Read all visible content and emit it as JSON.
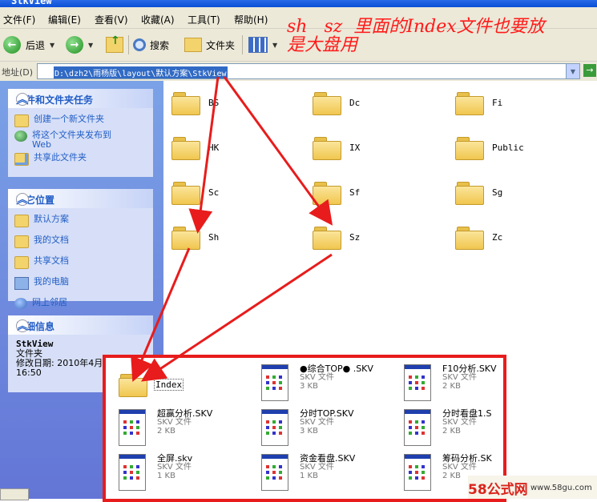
{
  "window": {
    "title": "StkView"
  },
  "menu": [
    "文件(F)",
    "编辑(E)",
    "查看(V)",
    "收藏(A)",
    "工具(T)",
    "帮助(H)"
  ],
  "toolbar": {
    "back": "后退",
    "search": "搜索",
    "folders": "文件夹"
  },
  "annotation": "sh   sz  里面的Index文件也要放\n是大盘用",
  "address": {
    "label": "地址(D)",
    "path": "D:\\dzh2\\雨杨版\\layout\\默认方案\\StkView"
  },
  "tasks_panel": {
    "title": "文件和文件夹任务",
    "items": [
      "创建一个新文件夹",
      "将这个文件夹发布到\nWeb",
      "共享此文件夹"
    ]
  },
  "places_panel": {
    "title": "其它位置",
    "items": [
      "默认方案",
      "我的文档",
      "共享文档",
      "我的电脑",
      "网上邻居"
    ]
  },
  "details_panel": {
    "title": "详细信息",
    "name": "StkView",
    "type": "文件夹",
    "modified": "修改日期: 2010年4月",
    "time": "16:50"
  },
  "folders": [
    "BS",
    "Dc",
    "Fi",
    "HK",
    "IX",
    "Public",
    "Sc",
    "Sf",
    "Sg",
    "Sh",
    "Sz",
    "Zc"
  ],
  "files": {
    "index_folder": "Index",
    "items": [
      {
        "name": "●综合TOP●  .SKV",
        "type": "SKV 文件",
        "size": "3 KB"
      },
      {
        "name": "F10分析.SKV",
        "type": "SKV 文件",
        "size": "2 KB"
      },
      {
        "name": "超赢分析.SKV",
        "type": "SKV 文件",
        "size": "2 KB"
      },
      {
        "name": "分时TOP.SKV",
        "type": "SKV 文件",
        "size": "3 KB"
      },
      {
        "name": "分时看盘1.S",
        "type": "SKV 文件",
        "size": "2 KB"
      },
      {
        "name": "全屏.skv",
        "type": "SKV 文件",
        "size": "1 KB"
      },
      {
        "name": "资金看盘.SKV",
        "type": "SKV 文件",
        "size": "1 KB"
      },
      {
        "name": "筹码分析.SK",
        "type": "SKV 文件",
        "size": "2 KB"
      }
    ]
  },
  "watermark": {
    "brand": "58公式网",
    "url": "www.58gu.com"
  },
  "colors": {
    "annotation": "#ff1a1a",
    "highlight": "#316ac5",
    "link": "#215dc6"
  }
}
